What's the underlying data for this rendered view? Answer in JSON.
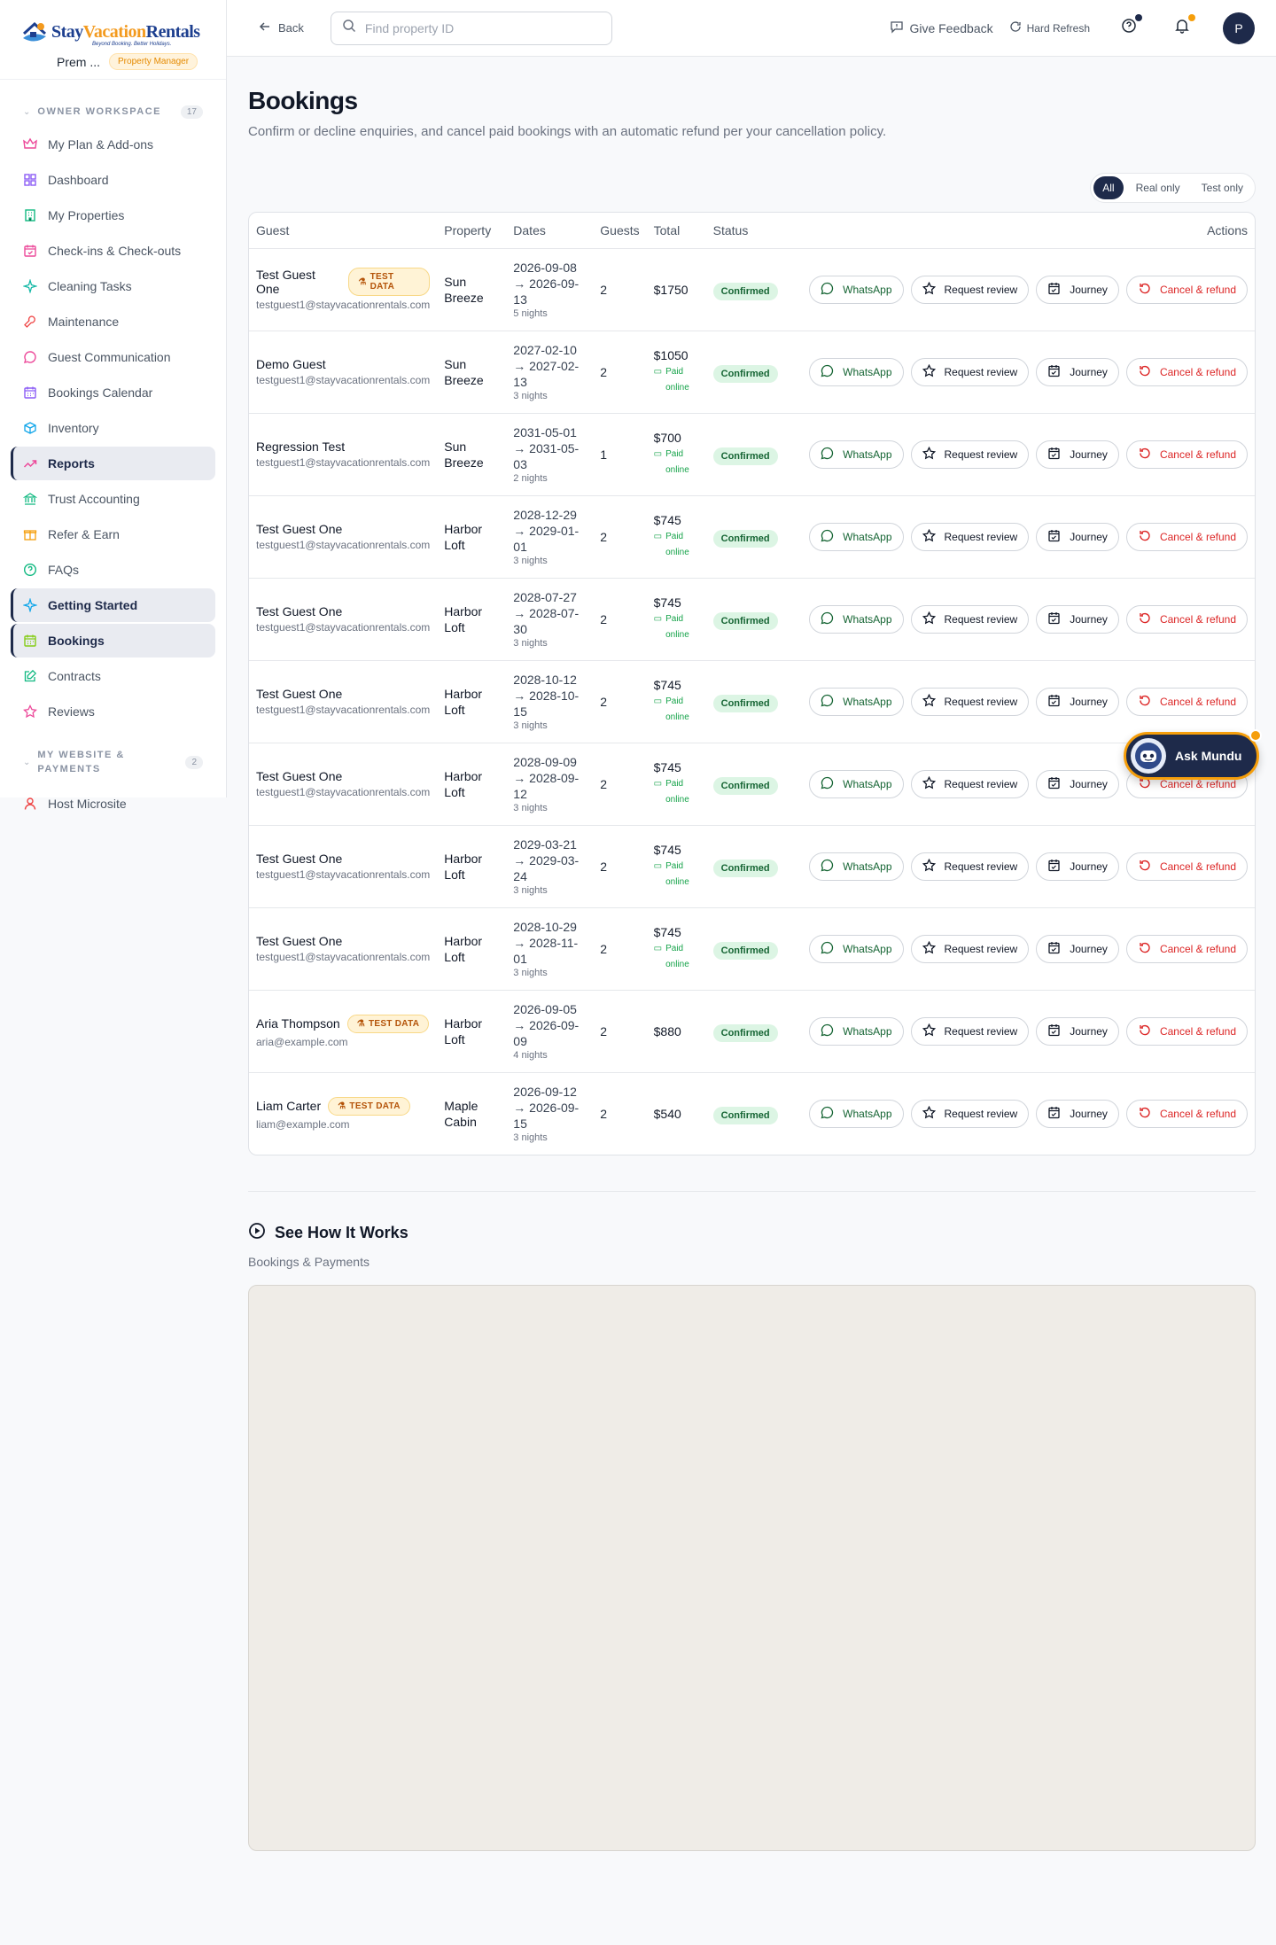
{
  "brand": {
    "logo_text_stay": "Stay",
    "logo_text_vacation": "Vacation",
    "logo_text_rentals": "Rentals",
    "tagline": "Beyond Booking. Better Holidays.",
    "user_name": "Prem ...",
    "role": "Property Manager"
  },
  "sidebar": {
    "owner_section": {
      "title": "OWNER WORKSPACE",
      "count": "17"
    },
    "items": [
      {
        "label": "My Plan & Add-ons",
        "icon": "crown-icon",
        "color": "#ec4899"
      },
      {
        "label": "Dashboard",
        "icon": "grid-icon",
        "color": "#8b5cf6"
      },
      {
        "label": "My Properties",
        "icon": "building-icon",
        "color": "#10b981"
      },
      {
        "label": "Check-ins & Check-outs",
        "icon": "calendar-check-icon",
        "color": "#ec4899"
      },
      {
        "label": "Cleaning Tasks",
        "icon": "sparkle-icon",
        "color": "#14b8a6"
      },
      {
        "label": "Maintenance",
        "icon": "wrench-icon",
        "color": "#ef4444"
      },
      {
        "label": "Guest Communication",
        "icon": "chat-icon",
        "color": "#ec4899"
      },
      {
        "label": "Bookings Calendar",
        "icon": "calendar-icon",
        "color": "#8b5cf6"
      },
      {
        "label": "Inventory",
        "icon": "box-icon",
        "color": "#0ea5e9"
      },
      {
        "label": "Reports",
        "icon": "trend-icon",
        "color": "#ec4899"
      },
      {
        "label": "Trust Accounting",
        "icon": "bank-icon",
        "color": "#10b981"
      },
      {
        "label": "Refer & Earn",
        "icon": "gift-icon",
        "color": "#f59e0b"
      },
      {
        "label": "FAQs",
        "icon": "help-circle-icon",
        "color": "#10b981"
      },
      {
        "label": "Getting Started",
        "icon": "sparkle-icon",
        "color": "#0ea5e9"
      },
      {
        "label": "Bookings",
        "icon": "calendar-icon",
        "color": "#84cc16"
      },
      {
        "label": "Contracts",
        "icon": "edit-icon",
        "color": "#10b981"
      },
      {
        "label": "Reviews",
        "icon": "star-icon",
        "color": "#ec4899"
      }
    ],
    "website_section": {
      "title_line1": "MY WEBSITE &",
      "title_line2": "PAYMENTS",
      "count": "2"
    },
    "website_items": [
      {
        "label": "Host Microsite",
        "icon": "user-icon",
        "color": "#ef4444"
      }
    ]
  },
  "topbar": {
    "back_label": "Back",
    "search_placeholder": "Find property ID",
    "feedback_label": "Give Feedback",
    "refresh_label": "Hard Refresh",
    "avatar_initial": "P"
  },
  "page": {
    "title": "Bookings",
    "subtitle": "Confirm or decline enquiries, and cancel paid bookings with an automatic refund per your cancellation policy.",
    "filters": [
      "All",
      "Real only",
      "Test only"
    ],
    "active_filter": "All"
  },
  "table": {
    "headers": [
      "Guest",
      "Property",
      "Dates",
      "Guests",
      "Total",
      "Status",
      "Actions"
    ],
    "action_labels": {
      "whatsapp": "WhatsApp",
      "review": "Request review",
      "journey": "Journey",
      "cancel": "Cancel & refund"
    },
    "test_badge": "TEST DATA",
    "rows": [
      {
        "name": "Test Guest One",
        "email": "testguest1@stayvacationrentals.com",
        "test": true,
        "property": "Sun Breeze",
        "date_start": "2026-09-08",
        "date_end": "→ 2026-09-13",
        "nights": "5 nights",
        "guests": "2",
        "total": "$1750",
        "paid": "",
        "status": "Confirmed"
      },
      {
        "name": "Demo Guest",
        "email": "testguest1@stayvacationrentals.com",
        "test": false,
        "property": "Sun Breeze",
        "date_start": "2027-02-10",
        "date_end": "→ 2027-02-13",
        "nights": "3 nights",
        "guests": "2",
        "total": "$1050",
        "paid": "Paid online",
        "status": "Confirmed"
      },
      {
        "name": "Regression Test",
        "email": "testguest1@stayvacationrentals.com",
        "test": false,
        "property": "Sun Breeze",
        "date_start": "2031-05-01",
        "date_end": "→ 2031-05-03",
        "nights": "2 nights",
        "guests": "1",
        "total": "$700",
        "paid": "Paid online",
        "status": "Confirmed"
      },
      {
        "name": "Test Guest One",
        "email": "testguest1@stayvacationrentals.com",
        "test": false,
        "property": "Harbor Loft",
        "date_start": "2028-12-29",
        "date_end": "→ 2029-01-01",
        "nights": "3 nights",
        "guests": "2",
        "total": "$745",
        "paid": "Paid online",
        "status": "Confirmed"
      },
      {
        "name": "Test Guest One",
        "email": "testguest1@stayvacationrentals.com",
        "test": false,
        "property": "Harbor Loft",
        "date_start": "2028-07-27",
        "date_end": "→ 2028-07-30",
        "nights": "3 nights",
        "guests": "2",
        "total": "$745",
        "paid": "Paid online",
        "status": "Confirmed"
      },
      {
        "name": "Test Guest One",
        "email": "testguest1@stayvacationrentals.com",
        "test": false,
        "property": "Harbor Loft",
        "date_start": "2028-10-12",
        "date_end": "→ 2028-10-15",
        "nights": "3 nights",
        "guests": "2",
        "total": "$745",
        "paid": "Paid online",
        "status": "Confirmed"
      },
      {
        "name": "Test Guest One",
        "email": "testguest1@stayvacationrentals.com",
        "test": false,
        "property": "Harbor Loft",
        "date_start": "2028-09-09",
        "date_end": "→ 2028-09-12",
        "nights": "3 nights",
        "guests": "2",
        "total": "$745",
        "paid": "Paid online",
        "status": "Confirmed"
      },
      {
        "name": "Test Guest One",
        "email": "testguest1@stayvacationrentals.com",
        "test": false,
        "property": "Harbor Loft",
        "date_start": "2029-03-21",
        "date_end": "→ 2029-03-24",
        "nights": "3 nights",
        "guests": "2",
        "total": "$745",
        "paid": "Paid online",
        "status": "Confirmed"
      },
      {
        "name": "Test Guest One",
        "email": "testguest1@stayvacationrentals.com",
        "test": false,
        "property": "Harbor Loft",
        "date_start": "2028-10-29",
        "date_end": "→ 2028-11-01",
        "nights": "3 nights",
        "guests": "2",
        "total": "$745",
        "paid": "Paid online",
        "status": "Confirmed"
      },
      {
        "name": "Aria Thompson",
        "email": "aria@example.com",
        "test": true,
        "property": "Harbor Loft",
        "date_start": "2026-09-05",
        "date_end": "→ 2026-09-09",
        "nights": "4 nights",
        "guests": "2",
        "total": "$880",
        "paid": "",
        "status": "Confirmed"
      },
      {
        "name": "Liam Carter",
        "email": "liam@example.com",
        "test": true,
        "property": "Maple Cabin",
        "date_start": "2026-09-12",
        "date_end": "→ 2026-09-15",
        "nights": "3 nights",
        "guests": "2",
        "total": "$540",
        "paid": "",
        "status": "Confirmed"
      }
    ]
  },
  "how_it_works": {
    "title": "See How It Works",
    "subtitle": "Bookings & Payments"
  },
  "assistant": {
    "label": "Ask Mundu"
  },
  "colors": {
    "navy": "#1e2a4a",
    "accent": "#f59e0b",
    "success": "#16a34a",
    "danger": "#dc2626"
  }
}
